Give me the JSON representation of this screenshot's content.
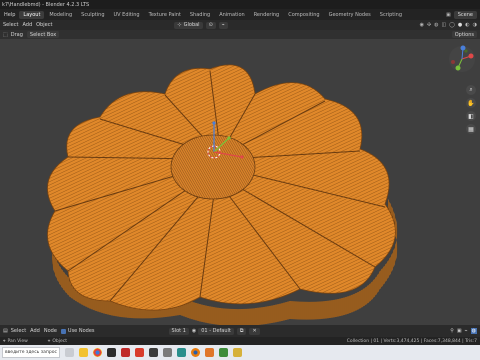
{
  "title_bar": {
    "text": "k7\\Handlebmd) - Blender 4.2.3 LTS"
  },
  "menus": [
    "Help"
  ],
  "workspaces": [
    "Layout",
    "Modeling",
    "Sculpting",
    "UV Editing",
    "Texture Paint",
    "Shading",
    "Animation",
    "Rendering",
    "Compositing",
    "Geometry Nodes",
    "Scripting"
  ],
  "active_workspace": "Layout",
  "scene": "Scene",
  "header": {
    "items": [
      "Select",
      "Add",
      "Object"
    ],
    "orientation": "Global",
    "options": "Options"
  },
  "toolbar": {
    "drag_label": "Drag",
    "mode": "Select Box"
  },
  "status": {
    "items": [
      "Select",
      "Add",
      "Node"
    ],
    "use_nodes": "Use Nodes",
    "slot": "Slot 1",
    "material": "01 - Default"
  },
  "info": {
    "pan": "Pan View",
    "object": "Object",
    "stats": "Collection | 01 | Verts:3,474,425 | Faces:7,348,844 | Tris:7"
  },
  "taskbar": {
    "search_placeholder": "введите здесь запрос"
  },
  "colors": {
    "wire": "#e0882a",
    "accent": "#4772b3"
  }
}
